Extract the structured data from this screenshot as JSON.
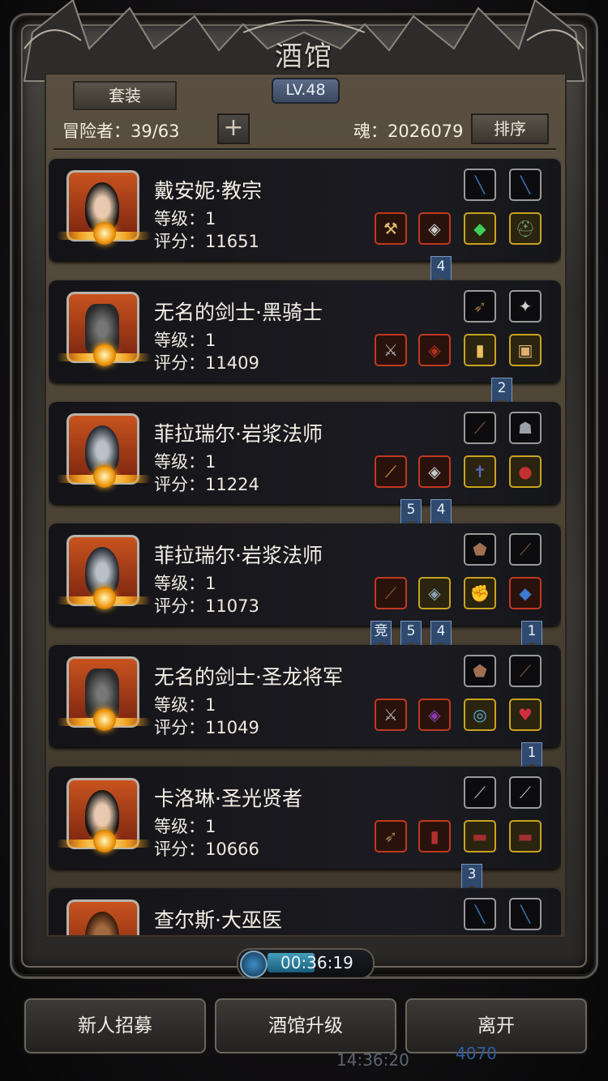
{
  "header": {
    "title": "酒馆",
    "level": "LV.48",
    "set_button": "套装",
    "adventurers": "冒险者：39/63",
    "add_icon": "plus-icon",
    "soul": "魂：2026079",
    "sort_button": "排序"
  },
  "heroes": [
    {
      "name": "戴安妮·教宗",
      "level": "等级：1",
      "score": "评分：11651",
      "slots": [
        "bow",
        "bow",
        "hammer",
        "armor",
        "gem",
        "helmet"
      ],
      "tags": [
        "4"
      ]
    },
    {
      "name": "无名的剑士·黑骑士",
      "level": "等级：1",
      "score": "评分：11409",
      "slots": [
        "bracer",
        "amulet",
        "sword",
        "armor",
        "scroll",
        "tome"
      ],
      "tags": [
        "2"
      ]
    },
    {
      "name": "菲拉瑞尔·岩浆法师",
      "level": "等级：1",
      "score": "评分：11224",
      "slots": [
        "feather",
        "mask",
        "staff",
        "armor",
        "cross",
        "pouch"
      ],
      "tags": [
        "5",
        "4"
      ]
    },
    {
      "name": "菲拉瑞尔·岩浆法师",
      "level": "等级：1",
      "score": "评分：11073",
      "slots": [
        "shield",
        "feather",
        "staff",
        "plate",
        "gauntlet",
        "gem"
      ],
      "tags": [
        "竞",
        "5",
        "4",
        "1"
      ]
    },
    {
      "name": "无名的剑士·圣龙将军",
      "level": "等级：1",
      "score": "评分：11049",
      "slots": [
        "shield",
        "feather",
        "sword",
        "armor",
        "ring",
        "necklace"
      ],
      "tags": [
        "1"
      ]
    },
    {
      "name": "卡洛琳·圣光贤者",
      "level": "等级：1",
      "score": "评分：10666",
      "slots": [
        "dagger",
        "dagger",
        "arrows",
        "robe",
        "belt",
        "belt"
      ],
      "tags": [
        "3"
      ]
    },
    {
      "name": "查尔斯·大巫医",
      "level": "",
      "score": "",
      "slots": [
        "bow",
        "bow"
      ],
      "tags": []
    }
  ],
  "timer": "00:36:19",
  "buttons": {
    "recruit": "新人招募",
    "upgrade": "酒馆升级",
    "leave": "离开"
  },
  "behind": {
    "time": "14:36:20",
    "gems": "4070"
  }
}
